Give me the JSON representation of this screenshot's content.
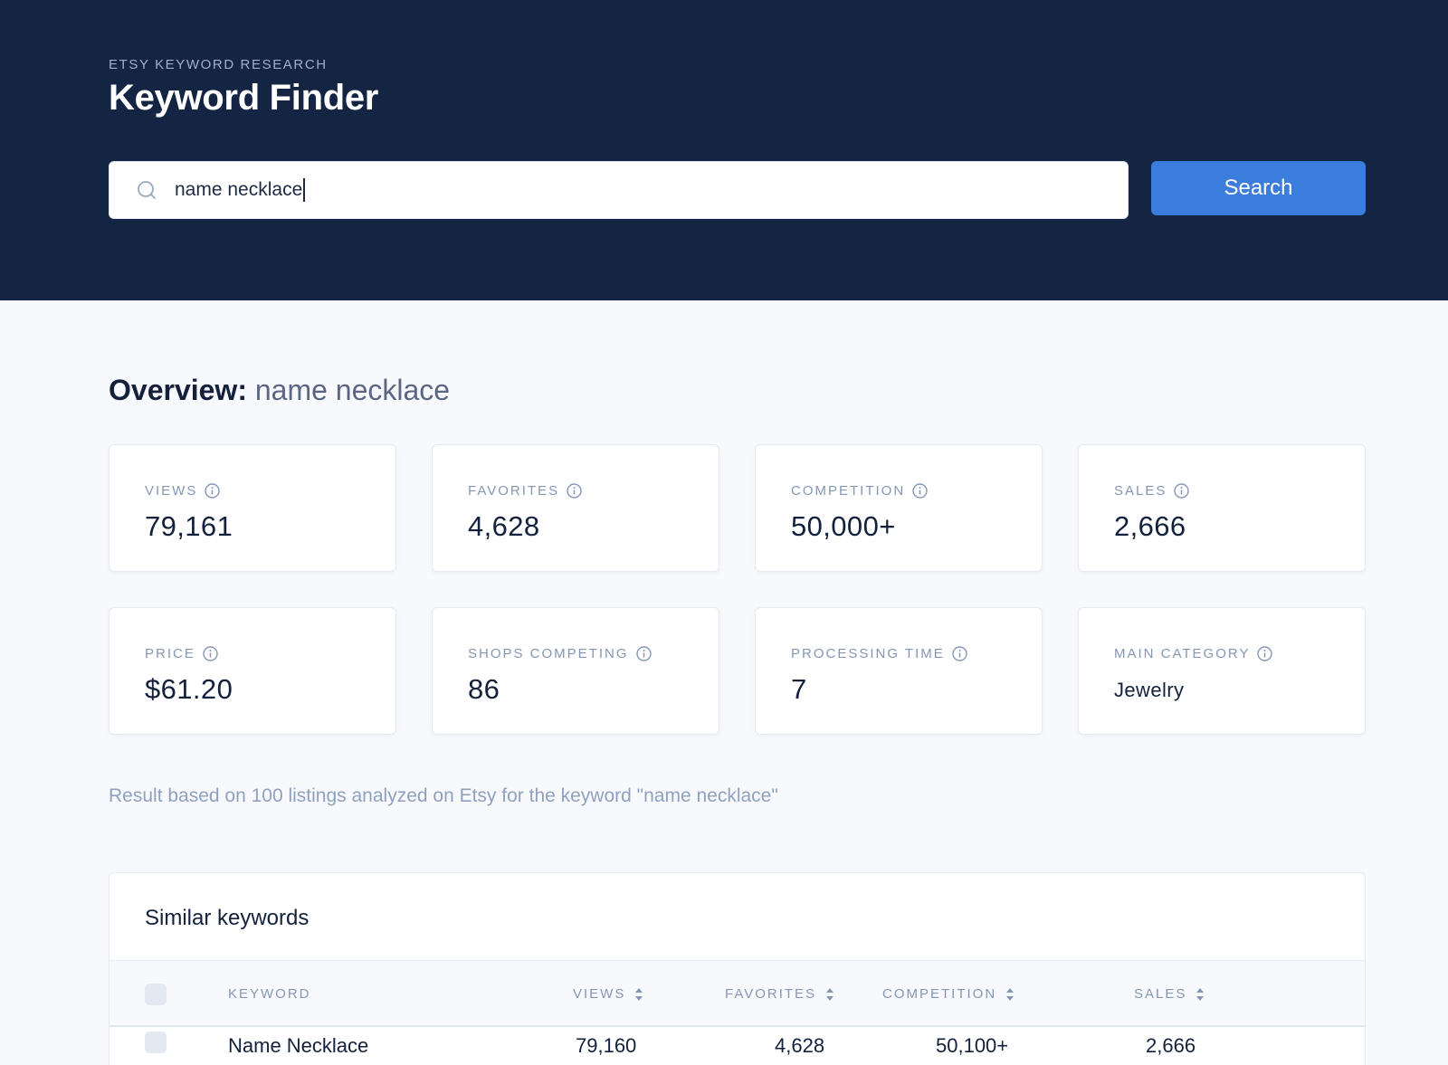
{
  "header": {
    "eyebrow": "ETSY KEYWORD RESEARCH",
    "title": "Keyword Finder",
    "search_value": "name necklace",
    "search_button": "Search"
  },
  "overview": {
    "label": "Overview:",
    "keyword": "name necklace",
    "cards": [
      {
        "label": "VIEWS",
        "value": "79,161"
      },
      {
        "label": "FAVORITES",
        "value": "4,628"
      },
      {
        "label": "COMPETITION",
        "value": "50,000+"
      },
      {
        "label": "SALES",
        "value": "2,666"
      },
      {
        "label": "PRICE",
        "value": "$61.20"
      },
      {
        "label": "SHOPS COMPETING",
        "value": "86"
      },
      {
        "label": "PROCESSING TIME",
        "value": "7"
      },
      {
        "label": "MAIN CATEGORY",
        "value": "Jewelry"
      }
    ],
    "note": "Result based on 100 listings analyzed on Etsy for the keyword \"name necklace\""
  },
  "similar": {
    "title": "Similar keywords",
    "columns": [
      "KEYWORD",
      "VIEWS",
      "FAVORITES",
      "COMPETITION",
      "SALES"
    ],
    "rows": [
      {
        "keyword": "Name Necklace",
        "views": "79,160",
        "favorites": "4,628",
        "competition": "50,100+",
        "sales": "2,666"
      }
    ]
  },
  "icons": {
    "search": "search-icon",
    "info": "info-icon",
    "sort": "sort-icon"
  },
  "colors": {
    "header_bg": "#132542",
    "accent": "#3b7ddd",
    "page_bg": "#f8f9fc"
  }
}
